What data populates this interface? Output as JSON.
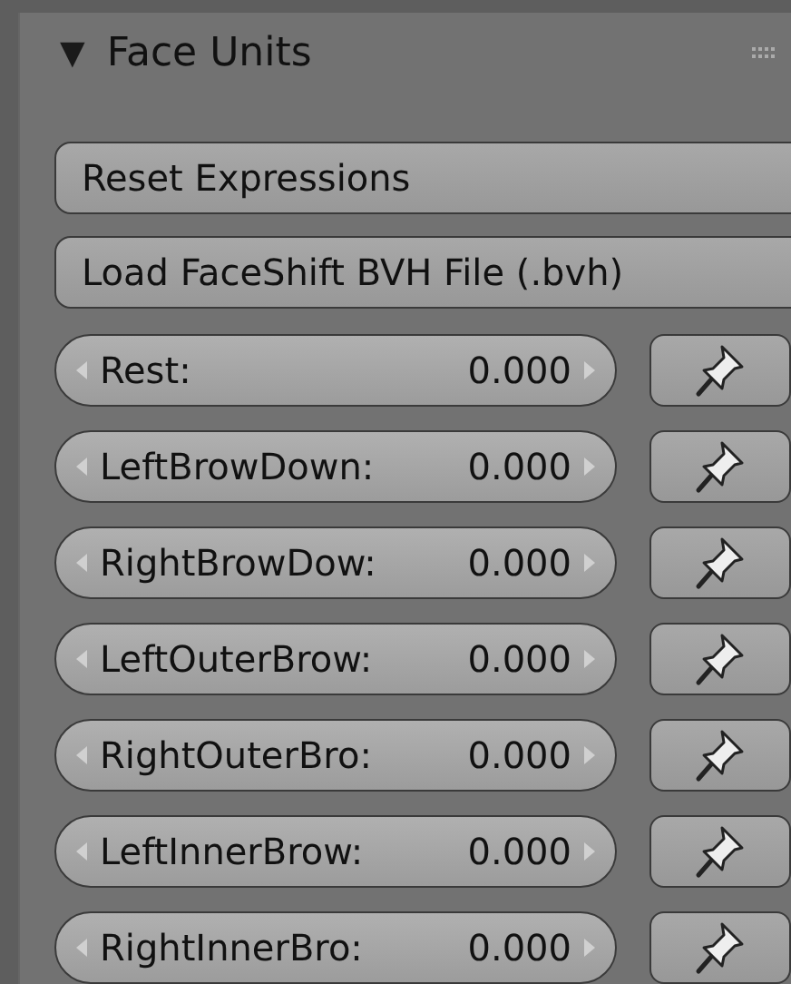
{
  "panel": {
    "title": "Face Units",
    "toggle": "▼",
    "expanded": true
  },
  "buttons": [
    "Reset Expressions",
    "Load FaceShift BVH File (.bvh)"
  ],
  "units": [
    {
      "label": "Rest:",
      "value": "0.000"
    },
    {
      "label": "LeftBrowDown:",
      "value": "0.000"
    },
    {
      "label": "RightBrowDow:",
      "value": "0.000"
    },
    {
      "label": "LeftOuterBrow:",
      "value": "0.000"
    },
    {
      "label": "RightOuterBro:",
      "value": "0.000"
    },
    {
      "label": "LeftInnerBrow:",
      "value": "0.000"
    },
    {
      "label": "RightInnerBro:",
      "value": "0.000"
    }
  ]
}
